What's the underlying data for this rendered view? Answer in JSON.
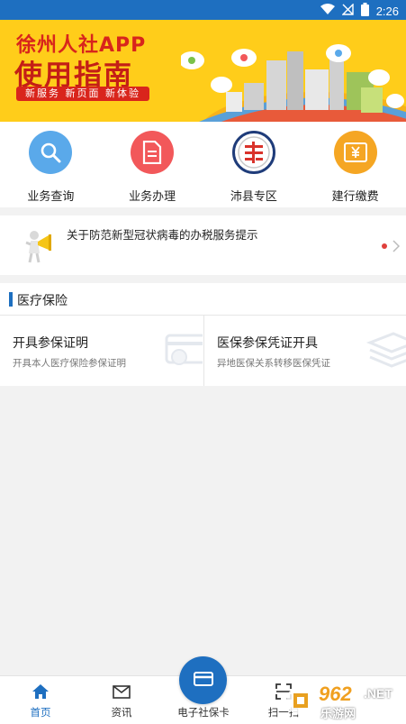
{
  "status_bar": {
    "time": "2:26",
    "icons": [
      "wifi-icon",
      "no-signal-icon",
      "battery-icon"
    ],
    "color": "#1e6fc0"
  },
  "banner": {
    "line1": "徐州人社APP",
    "line2": "使用指南",
    "line3": "新服务 新页面 新体验",
    "background": "#ffcd1a"
  },
  "quick_actions": [
    {
      "label": "业务查询",
      "icon": "search-icon",
      "color": "#5aa9ea"
    },
    {
      "label": "业务办理",
      "icon": "document-icon",
      "color": "#f2585a"
    },
    {
      "label": "沛县专区",
      "icon": "han-seal-icon",
      "color": "#d9332b"
    },
    {
      "label": "建行缴费",
      "icon": "yuan-icon",
      "color": "#f5a623"
    }
  ],
  "notice": {
    "text": "关于防范新型冠状病毒的办税服务提示",
    "icon": "megaphone-icon"
  },
  "section": {
    "title": "医疗保险",
    "cards": [
      {
        "title": "开具参保证明",
        "subtitle": "开具本人医疗保险参保证明",
        "icon": "card-icon"
      },
      {
        "title": "医保参保凭证开具",
        "subtitle": "异地医保关系转移医保凭证",
        "icon": "stack-icon"
      }
    ]
  },
  "tabbar": {
    "tabs": [
      {
        "label": "首页",
        "icon": "home-icon",
        "active": true
      },
      {
        "label": "资讯",
        "icon": "mail-icon",
        "active": false
      },
      {
        "label": "电子社保卡",
        "icon": "card-icon",
        "active": false
      },
      {
        "label": "扫一扫",
        "icon": "scan-icon",
        "active": false
      }
    ],
    "accent": "#1e6fc0"
  },
  "watermark": {
    "brand": "962",
    "domain": ".NET",
    "text": "乐游网"
  }
}
